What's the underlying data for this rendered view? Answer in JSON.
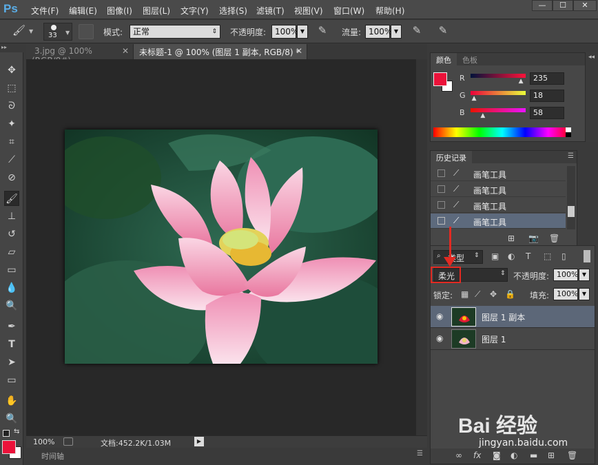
{
  "app": {
    "logo": "Ps"
  },
  "menu": [
    "文件(F)",
    "编辑(E)",
    "图像(I)",
    "图层(L)",
    "文字(Y)",
    "选择(S)",
    "滤镜(T)",
    "视图(V)",
    "窗口(W)",
    "帮助(H)"
  ],
  "window_buttons": [
    "—",
    "☐",
    "✕"
  ],
  "options": {
    "brush_size": "33",
    "mode_label": "模式:",
    "mode_value": "正常",
    "opacity_label": "不透明度:",
    "opacity_value": "100%",
    "flow_label": "流量:",
    "flow_value": "100%"
  },
  "tools": [
    "move-tool",
    "marquee-tool",
    "lasso-tool",
    "quick-select-tool",
    "crop-tool",
    "eyedropper-tool",
    "healing-tool",
    "brush-tool",
    "stamp-tool",
    "history-brush-tool",
    "eraser-tool",
    "gradient-tool",
    "blur-tool",
    "dodge-tool",
    "pen-tool",
    "type-tool",
    "path-select-tool",
    "shape-tool",
    "hand-tool",
    "zoom-tool"
  ],
  "document_tabs": [
    "3.jpg @ 100%(RGB/8#)",
    "未标题-1 @ 100% (图层 1 副本, RGB/8) *"
  ],
  "status": {
    "zoom": "100%",
    "doc_info": "文档:452.2K/1.03M"
  },
  "timeline_label": "时间轴",
  "color_panel": {
    "tabs": [
      "颜色",
      "色板"
    ],
    "foreground": "#EB123A",
    "channels": [
      {
        "name": "R",
        "value": "235",
        "fraction": 0.92
      },
      {
        "name": "G",
        "value": "18",
        "fraction": 0.07
      },
      {
        "name": "B",
        "value": "58",
        "fraction": 0.23
      }
    ]
  },
  "history_panel": {
    "tab": "历史记录",
    "items": [
      "画笔工具",
      "画笔工具",
      "画笔工具",
      "画笔工具"
    ]
  },
  "layers_panel": {
    "filter_label": "类型",
    "blend_mode": "柔光",
    "opacity_label": "不透明度:",
    "opacity_value": "100%",
    "lock_label": "锁定:",
    "fill_label": "填充:",
    "fill_value": "100%",
    "layers": [
      {
        "name": "图层 1 副本",
        "selected": true
      },
      {
        "name": "图层 1",
        "selected": false
      }
    ]
  },
  "watermark": {
    "brand": "Bai 经验",
    "url": "jingyan.baidu.com"
  }
}
